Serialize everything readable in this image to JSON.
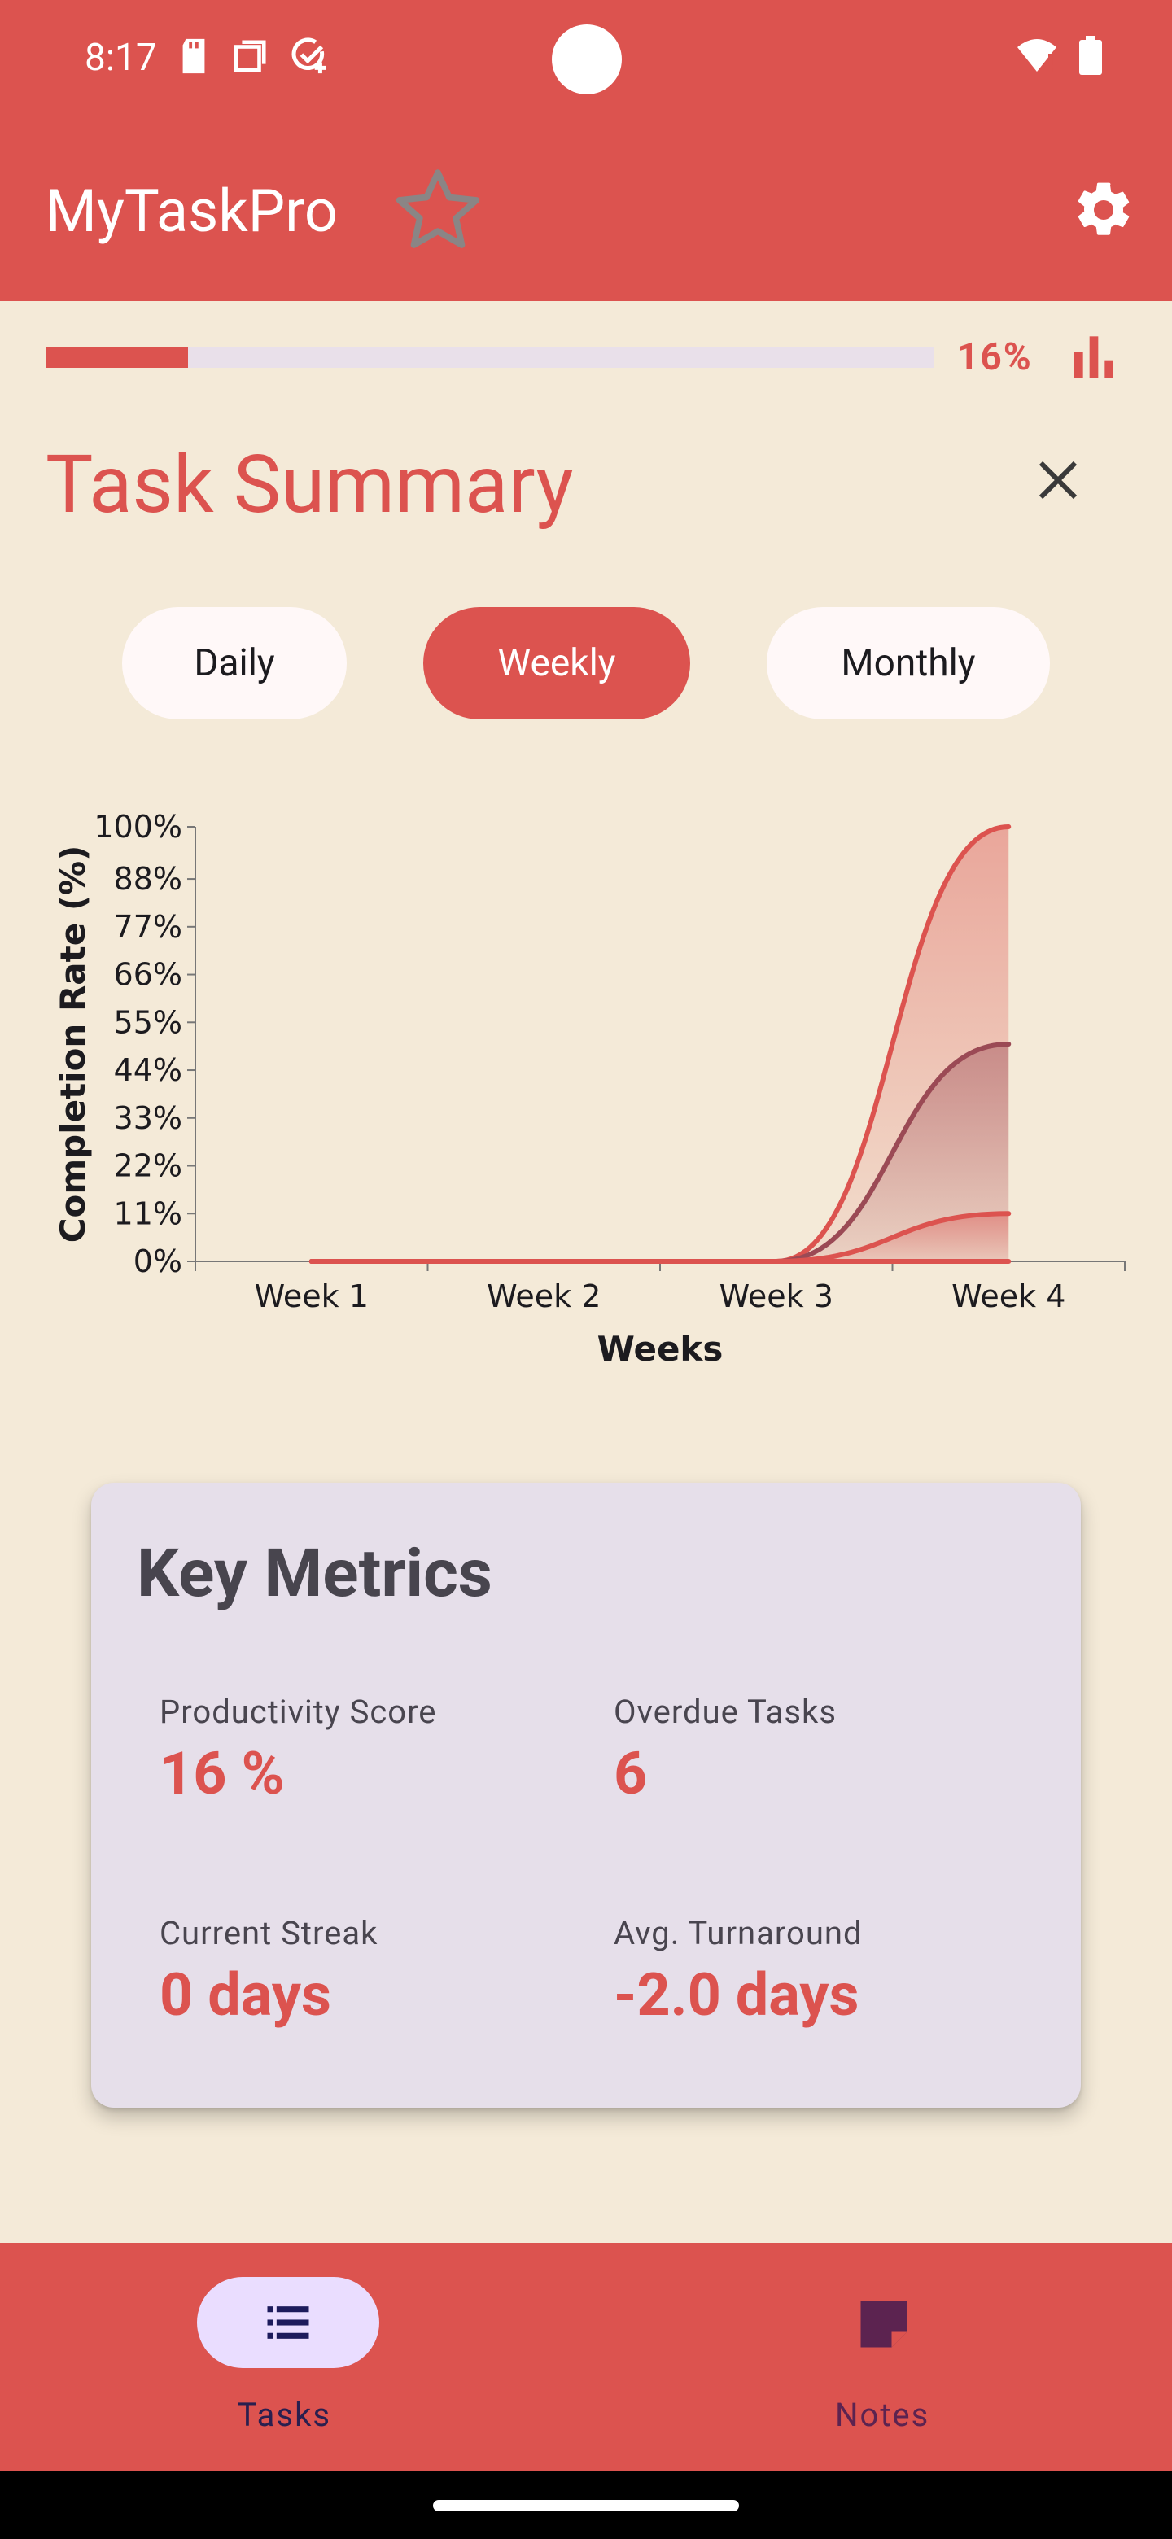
{
  "status_bar": {
    "time": "8:17"
  },
  "app_bar": {
    "title": "MyTaskPro"
  },
  "progress": {
    "value": 0.16,
    "label": "16%"
  },
  "summary": {
    "title": "Task Summary"
  },
  "segments": {
    "daily": "Daily",
    "weekly": "Weekly",
    "monthly": "Monthly",
    "selected": "Weekly"
  },
  "chart_data": {
    "type": "area",
    "categories": [
      "Week 1",
      "Week 2",
      "Week 3",
      "Week 4"
    ],
    "xlabel": "Weeks",
    "ylabel": "Completion Rate (%)",
    "ylim": [
      0,
      100
    ],
    "yticks": [
      "0%",
      "11%",
      "22%",
      "33%",
      "44%",
      "55%",
      "66%",
      "77%",
      "88%",
      "100%"
    ],
    "series": [
      {
        "values": [
          0,
          0,
          0,
          100
        ],
        "color": "#dc534f"
      },
      {
        "values": [
          0,
          0,
          0,
          50
        ],
        "color": "#9b4a55"
      },
      {
        "values": [
          0,
          0,
          0,
          11
        ],
        "color": "#dc534f"
      },
      {
        "values": [
          0,
          0,
          0,
          0
        ],
        "color": "#dc534f"
      }
    ],
    "grid": false
  },
  "metrics": {
    "title": "Key Metrics",
    "items": [
      {
        "label": "Productivity Score",
        "value": "16 %"
      },
      {
        "label": "Overdue Tasks",
        "value": "6"
      },
      {
        "label": "Current Streak",
        "value": "0 days"
      },
      {
        "label": "Avg. Turnaround",
        "value": "-2.0 days"
      }
    ]
  },
  "nav": {
    "items": [
      {
        "label": "Tasks",
        "icon": "list-icon",
        "selected": true
      },
      {
        "label": "Notes",
        "icon": "note-icon",
        "selected": false
      }
    ]
  },
  "colors": {
    "accent": "#dc534f",
    "background": "#f4ead8",
    "card": "#e6dfea"
  }
}
